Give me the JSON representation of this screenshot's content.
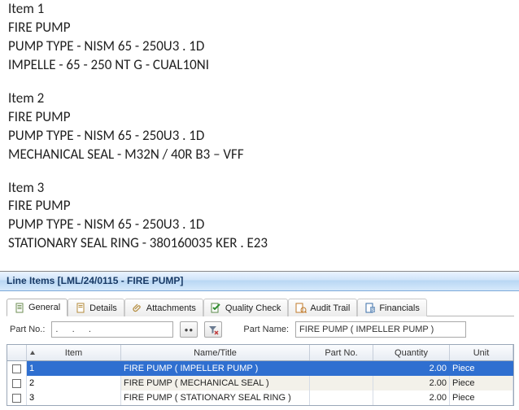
{
  "doc": {
    "items": [
      {
        "title": "Item 1",
        "lines": [
          "FIRE PUMP",
          "PUMP TYPE - NISM 65 - 250U3 . 1D",
          "IMPELLE - 65 - 250 NT G - CUAL10NI"
        ]
      },
      {
        "title": "Item 2",
        "lines": [
          "FIRE PUMP",
          "PUMP TYPE - NISM 65 - 250U3 . 1D",
          "MECHANICAL SEAL - M32N / 40R B3 – VFF"
        ]
      },
      {
        "title": "Item 3",
        "lines": [
          "FIRE PUMP",
          "PUMP TYPE - NISM 65 - 250U3 . 1D",
          "STATIONARY SEAL RING - 380160035 KER . E23"
        ]
      }
    ]
  },
  "panel": {
    "title": "Line Items [LML/24/0115 - FIRE PUMP]",
    "tabs": {
      "general": "General",
      "details": "Details",
      "attachments": "Attachments",
      "qc": "Quality Check",
      "audit": "Audit Trail",
      "financials": "Financials"
    },
    "filter": {
      "partno_label": "Part No.:",
      "partno_value": ".   .   .",
      "partname_label": "Part Name:",
      "partname_value": "FIRE PUMP ( IMPELLER PUMP )"
    },
    "grid": {
      "headers": {
        "item": "Item",
        "name": "Name/Title",
        "partno": "Part No.",
        "qty": "Quantity",
        "unit": "Unit"
      },
      "rows": [
        {
          "item": "1",
          "name": "FIRE PUMP ( IMPELLER PUMP )",
          "partno": "",
          "qty": "2.00",
          "unit": "Piece"
        },
        {
          "item": "2",
          "name": "FIRE PUMP ( MECHANICAL SEAL )",
          "partno": "",
          "qty": "2.00",
          "unit": "Piece"
        },
        {
          "item": "3",
          "name": "FIRE PUMP ( STATIONARY SEAL RING )",
          "partno": "",
          "qty": "2.00",
          "unit": "Piece"
        }
      ]
    }
  }
}
